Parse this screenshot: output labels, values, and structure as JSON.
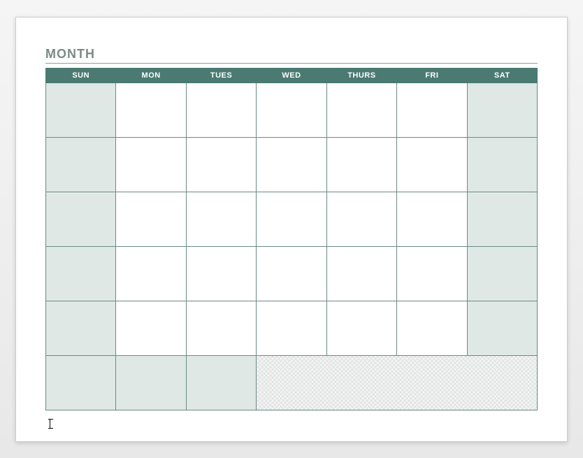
{
  "title": "MONTH",
  "days": {
    "sun": "SUN",
    "mon": "MON",
    "tues": "TUES",
    "wed": "WED",
    "thurs": "THURS",
    "fri": "FRI",
    "sat": "SAT"
  },
  "rows": 6,
  "colors": {
    "header_bg": "#4a7a72",
    "header_text": "#ffffff",
    "weekend_bg": "#dfe8e5",
    "border": "#6b8a85",
    "title_color": "#7a8b86"
  }
}
